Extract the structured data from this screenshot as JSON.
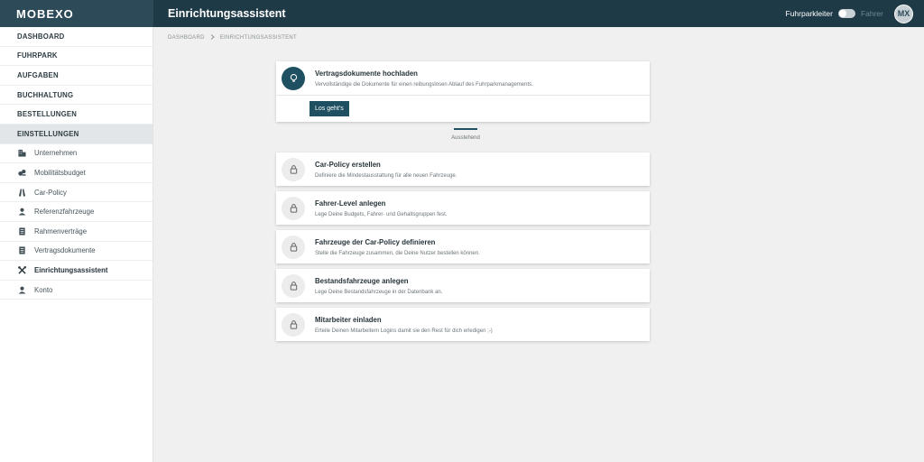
{
  "app": {
    "brand": "MOBEXO",
    "title": "Einrichtungsassistent"
  },
  "header": {
    "role_active": "Fuhrparkleiter",
    "role_inactive": "Fahrer",
    "avatar_initials": "MX"
  },
  "breadcrumb": {
    "root": "DASHBOARD",
    "current": "EINRICHTUNGSASSISTENT"
  },
  "sidebar": {
    "nav": [
      {
        "label": "DASHBOARD"
      },
      {
        "label": "FUHRPARK"
      },
      {
        "label": "AUFGABEN"
      },
      {
        "label": "BUCHHALTUNG"
      },
      {
        "label": "BESTELLUNGEN"
      },
      {
        "label": "EINSTELLUNGEN"
      }
    ],
    "sub": [
      {
        "label": "Unternehmen",
        "icon": "building-icon"
      },
      {
        "label": "Mobilitätsbudget",
        "icon": "coins-icon"
      },
      {
        "label": "Car-Policy",
        "icon": "road-icon"
      },
      {
        "label": "Referenzfahrzeuge",
        "icon": "person-icon"
      },
      {
        "label": "Rahmenverträge",
        "icon": "document-icon"
      },
      {
        "label": "Vertragsdokumente",
        "icon": "document-icon"
      },
      {
        "label": "Einrichtungsassistent",
        "icon": "tools-icon"
      },
      {
        "label": "Konto",
        "icon": "person-icon"
      }
    ]
  },
  "primary_task": {
    "title": "Vertragsdokumente hochladen",
    "desc": "Vervollständige die Dokumente für einen reibungslosen Ablauf des Fuhrparkmanagements.",
    "button": "Los geht's",
    "icon": "lightbulb-icon"
  },
  "status": "Ausstehend",
  "tasks": [
    {
      "title": "Car-Policy erstellen",
      "desc": "Definiere die Mindestausstattung für alle neuen Fahrzeuge."
    },
    {
      "title": "Fahrer-Level anlegen",
      "desc": "Lege Deine Budgets, Fahrer- und Gehaltsgruppen fest."
    },
    {
      "title": "Fahrzeuge der Car-Policy definieren",
      "desc": "Stelle die Fahrzeuge zusammen, die Deine Nutzer bestellen können."
    },
    {
      "title": "Bestandsfahrzeuge anlegen",
      "desc": "Lege Deine Bestandsfahrzeuge in der Datenbank an."
    },
    {
      "title": "Mitarbeiter einladen",
      "desc": "Erteile Deinen Mitarbeitern Logins damit sie den Rest für dich erledigen ;-)"
    }
  ],
  "colors": {
    "header": "#1f3a47",
    "accent": "#1e5062",
    "sidebar_active": "#e2e6e8"
  }
}
